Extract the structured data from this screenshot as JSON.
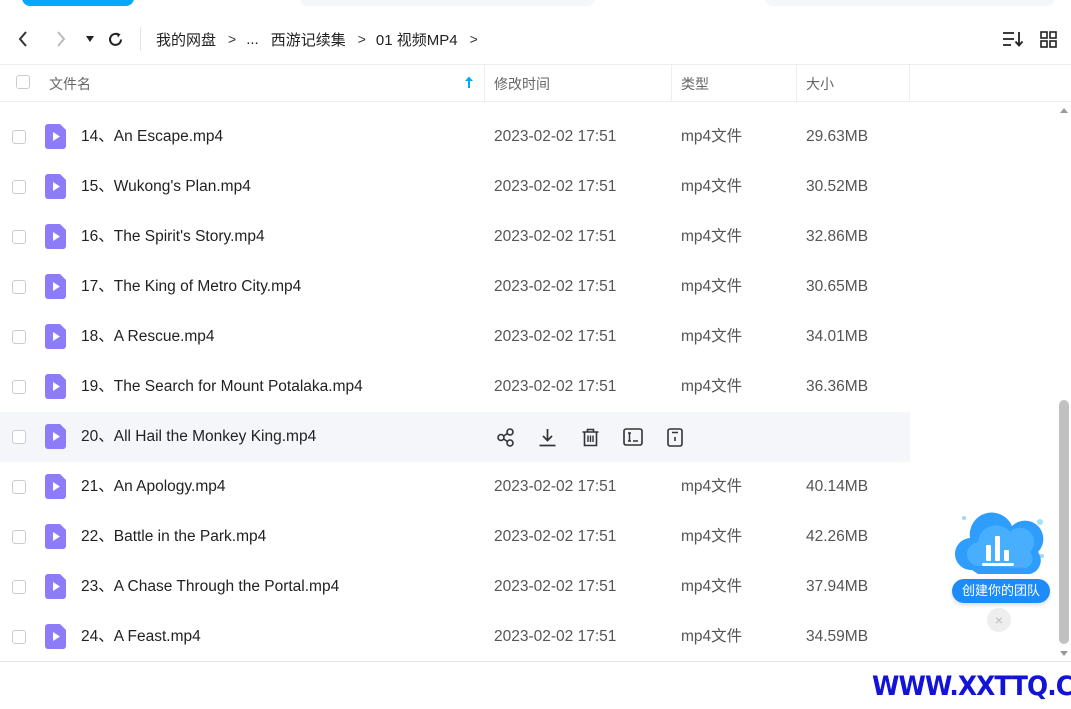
{
  "breadcrumb": {
    "items": [
      "我的网盘",
      "...",
      "西游记续集",
      "01 视频MP4"
    ],
    "separator": ">"
  },
  "table": {
    "columns": {
      "name": "文件名",
      "time": "修改时间",
      "type": "类型",
      "size": "大小"
    },
    "rows": [
      {
        "name": "14、An Escape.mp4",
        "time": "2023-02-02 17:51",
        "type": "mp4文件",
        "size": "29.63MB"
      },
      {
        "name": "15、Wukong's Plan.mp4",
        "time": "2023-02-02 17:51",
        "type": "mp4文件",
        "size": "30.52MB"
      },
      {
        "name": "16、The Spirit's Story.mp4",
        "time": "2023-02-02 17:51",
        "type": "mp4文件",
        "size": "32.86MB"
      },
      {
        "name": "17、The King of Metro City.mp4",
        "time": "2023-02-02 17:51",
        "type": "mp4文件",
        "size": "30.65MB"
      },
      {
        "name": "18、A Rescue.mp4",
        "time": "2023-02-02 17:51",
        "type": "mp4文件",
        "size": "34.01MB"
      },
      {
        "name": "19、The Search for Mount Potalaka.mp4",
        "time": "2023-02-02 17:51",
        "type": "mp4文件",
        "size": "36.36MB"
      },
      {
        "name": "20、All Hail the Monkey King.mp4",
        "hovered": true
      },
      {
        "name": "21、An Apology.mp4",
        "time": "2023-02-02 17:51",
        "type": "mp4文件",
        "size": "40.14MB"
      },
      {
        "name": "22、Battle in the Park.mp4",
        "time": "2023-02-02 17:51",
        "type": "mp4文件",
        "size": "42.26MB"
      },
      {
        "name": "23、A Chase Through the Portal.mp4",
        "time": "2023-02-02 17:51",
        "type": "mp4文件",
        "size": "37.94MB"
      },
      {
        "name": "24、A Feast.mp4",
        "time": "2023-02-02 17:51",
        "type": "mp4文件",
        "size": "34.59MB"
      }
    ]
  },
  "row_actions": [
    "share-icon",
    "download-icon",
    "delete-icon",
    "rename-icon",
    "copy-icon"
  ],
  "team_widget": {
    "label": "创建你的团队",
    "close": "×"
  },
  "watermark": "WWW.XXTTQ.COM",
  "colors": {
    "accent": "#06a7ff",
    "file_icon": "#8c7cf7",
    "team_button": "#1d8cf8",
    "watermark": "#1212d8"
  }
}
